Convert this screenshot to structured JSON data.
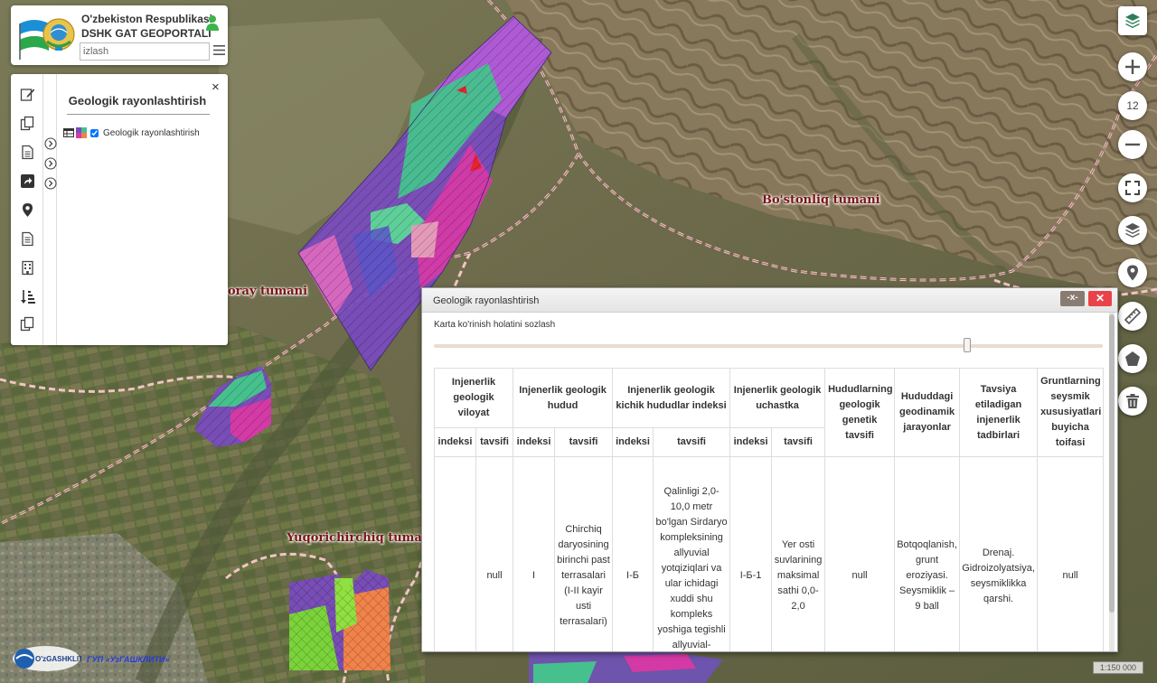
{
  "header": {
    "title_line1": "O'zbekiston Respublikasi",
    "title_line2": "DSHK GAT GEOPORTALI",
    "search_placeholder": "izlash"
  },
  "side_panel": {
    "title": "Geologik rayonlashtirish",
    "close_label": "×",
    "layer": {
      "label": "Geologik rayonlashtirish",
      "checked": true
    },
    "tools": [
      "edit-icon",
      "copy-icon",
      "document-icon",
      "share-icon",
      "map-pin-icon",
      "document-list-icon",
      "building-icon",
      "sort-icon",
      "copy-icon"
    ]
  },
  "map": {
    "labels": {
      "bostonliq": "Bo'stonliq tumani",
      "ohangaron": "oray tumani",
      "yuqorichirchiq": "Yuqorichirchiq tumani"
    }
  },
  "controls": {
    "zoom_level": "12"
  },
  "dialog": {
    "title": "Geologik rayonlashtirish",
    "min_label": "-x-",
    "close_label": "✕",
    "settings_label": "Karta ko'rinish holatini sozlash",
    "opacity_slider_value": 0.797,
    "table": {
      "group_headers": [
        "Injenerlik geologik viloyat",
        "Injenerlik geologik hudud",
        "Injenerlik geologik kichik hududlar indeksi",
        "Injenerlik geologik uchastka",
        "Hududlarning geologik genetik tavsifi",
        "Hududdagi geodinamik jarayonlar",
        "Tavsiya etiladigan injenerlik tadbirlari",
        "Gruntlarning seysmik xususiyatlari buyicha toifasi"
      ],
      "sub_headers": [
        "indeksi",
        "tavsifi",
        "indeksi",
        "tavsifi",
        "indeksi",
        "tavsifi",
        "indeksi",
        "tavsifi"
      ],
      "row": [
        "",
        "null",
        "I",
        "Chirchiq daryosining birinchi past terrasalari (I-II kayir usti terrasalari)",
        "I-Б",
        "Qalinligi 2,0-10,0 metr bo'lgan Sirdaryo kompleksining allyuvial yotqiziqlari va ular ichidagi xuddi shu kompleks yoshiga tegishli allyuvial-prolyuvial",
        "I-Б-1",
        "Yer osti suvlarining maksimal sathi 0,0-2,0",
        "null",
        "Botqoqlanish, grunt eroziyasi. Seysmiklik – 9 ball",
        "Drenaj. Gidroizolyatsiya, seysmiklikka qarshi.",
        "null"
      ]
    }
  },
  "footer": {
    "logo_text": "O'zGASHKLITI",
    "link_text": "ГУП «УзГАШКЛИТИ»",
    "scale": "1:150 000"
  }
}
